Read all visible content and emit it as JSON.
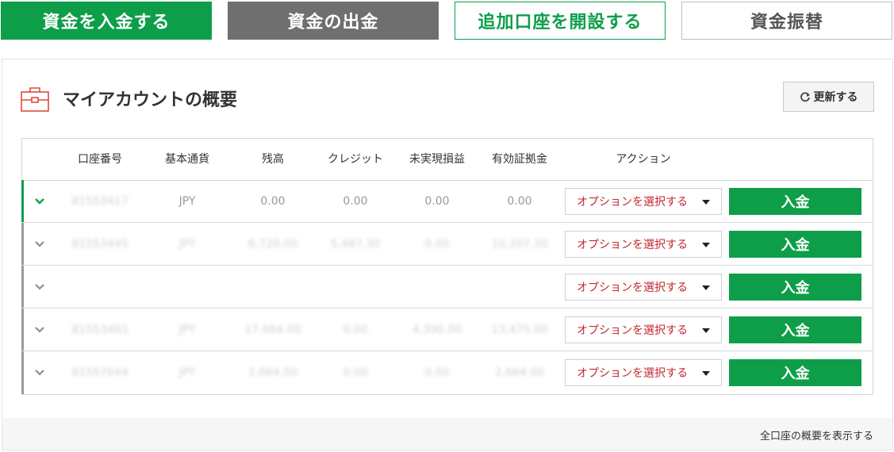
{
  "top_actions": [
    {
      "label": "資金を入金する"
    },
    {
      "label": "資金の出金"
    },
    {
      "label": "追加口座を開設する"
    },
    {
      "label": "資金振替"
    }
  ],
  "header": {
    "title": "マイアカウントの概要",
    "refresh_label": "更新する",
    "icon": "briefcase-icon"
  },
  "table": {
    "columns": [
      "口座番号",
      "基本通貨",
      "残高",
      "クレジット",
      "未実現損益",
      "有効証拠金",
      "アクション"
    ],
    "rows": [
      {
        "account": "81553417",
        "currency": "JPY",
        "balance": "0.00",
        "credit": "0.00",
        "unrealized": "0.00",
        "equity": "0.00",
        "select": "オプションを選択する",
        "deposit": "入金"
      },
      {
        "account": "81553445",
        "currency": "JPY",
        "balance": "6,720.00",
        "credit": "5,487.30",
        "unrealized": "0.00",
        "equity": "10,207.30",
        "select": "オプションを選択する",
        "deposit": "入金"
      },
      {
        "account": "",
        "currency": "",
        "balance": "",
        "credit": "",
        "unrealized": "",
        "equity": "",
        "select": "オプションを選択する",
        "deposit": "入金"
      },
      {
        "account": "81553483",
        "currency": "JPY",
        "balance": "17,664.00",
        "credit": "0.00",
        "unrealized": "4,390.00",
        "equity": "13,475.00",
        "select": "オプションを選択する",
        "deposit": "入金"
      },
      {
        "account": "81557644",
        "currency": "JPY",
        "balance": "2,664.00",
        "credit": "0.00",
        "unrealized": "0.00",
        "equity": "2,664.00",
        "select": "オプションを選択する",
        "deposit": "入金"
      }
    ]
  },
  "footer": {
    "show_all_label": "全口座の概要を表示する"
  },
  "colors": {
    "accent": "#0e9e4a",
    "select_text": "#c0282d",
    "dark_button": "#6f6f6f"
  }
}
